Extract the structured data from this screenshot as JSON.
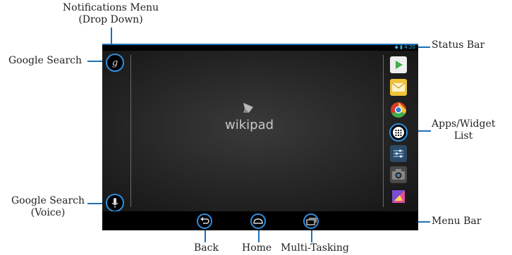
{
  "callouts": {
    "notifications_line1": "Notifications Menu",
    "notifications_line2": "(Drop Down)",
    "google_search": "Google Search",
    "google_voice_line1": "Google Search",
    "google_voice_line2": "(Voice)",
    "status_bar": "Status Bar",
    "apps_line1": "Apps/Widget",
    "apps_line2": "List",
    "menu_bar": "Menu Bar",
    "back": "Back",
    "home": "Home",
    "multitasking": "Multi-Tasking"
  },
  "device": {
    "status_time": "4:20",
    "logo_text": "wikipad",
    "search_glyph": "g",
    "apps": [
      {
        "name": "play-store",
        "color": "#e8e8e8"
      },
      {
        "name": "email",
        "color": "#f2c23a"
      },
      {
        "name": "chrome",
        "color": "#d83a2e"
      },
      {
        "name": "settings",
        "color": "#3a5a7a"
      },
      {
        "name": "camera",
        "color": "#555555"
      },
      {
        "name": "gallery",
        "color": "#c45aa8"
      }
    ]
  },
  "colors": {
    "accent": "#1e6fb8",
    "ring": "#2f8fe0"
  }
}
